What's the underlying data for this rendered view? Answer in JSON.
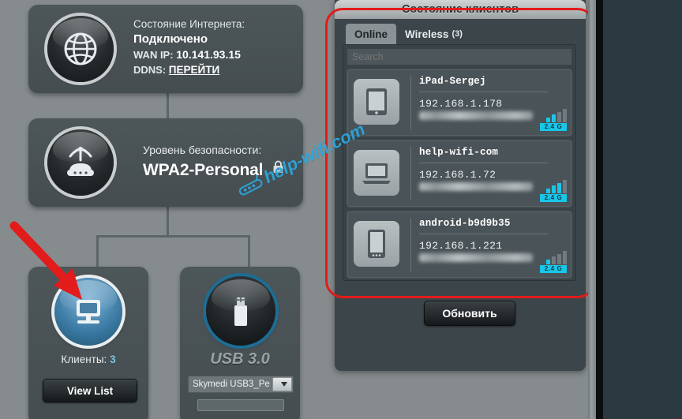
{
  "network": {
    "internet_status_label": "Состояние Интернета:",
    "internet_status_value": "Подключено",
    "wan_label": "WAN IP:",
    "wan_ip": "10.141.93.15",
    "ddns_label": "DDNS:",
    "ddns_link": "ПЕРЕЙТИ"
  },
  "security": {
    "label": "Уровень безопасности:",
    "value": "WPA2-Personal",
    "lock_icon": "lock-icon"
  },
  "clients_card": {
    "count_label": "Клиенты:",
    "count": "3",
    "button": "View List",
    "icon": "monitor-icon"
  },
  "usb_card": {
    "title": "USB 3.0",
    "device": "Skymedi  USB3_Pe",
    "icon": "usb-drive-icon",
    "dropdown_icon": "chevron-down-icon"
  },
  "client_status": {
    "title": "Состояние клиентов",
    "tabs": [
      {
        "label": "Online",
        "count": "",
        "active": true
      },
      {
        "label": "Wireless",
        "count": "(3)",
        "active": false
      }
    ],
    "search_placeholder": "Search",
    "refresh_button": "Обновить",
    "clients": [
      {
        "name": "iPad-Sergej",
        "ip": "192.168.1.178",
        "icon": "tablet-icon",
        "band": "2.4 G",
        "signal": 2
      },
      {
        "name": "help-wifi-com",
        "ip": "192.168.1.72",
        "icon": "laptop-icon",
        "band": "2.4 G",
        "signal": 3
      },
      {
        "name": "android-b9d9b35",
        "ip": "192.168.1.221",
        "icon": "phone-icon",
        "band": "2.4 G",
        "signal": 1
      }
    ]
  },
  "annotations": {
    "highlight_color": "#e21b1b",
    "arrow_color": "#e21b1b",
    "watermark_text": "help-wifi.com",
    "watermark_color": "#2aa9e0"
  }
}
